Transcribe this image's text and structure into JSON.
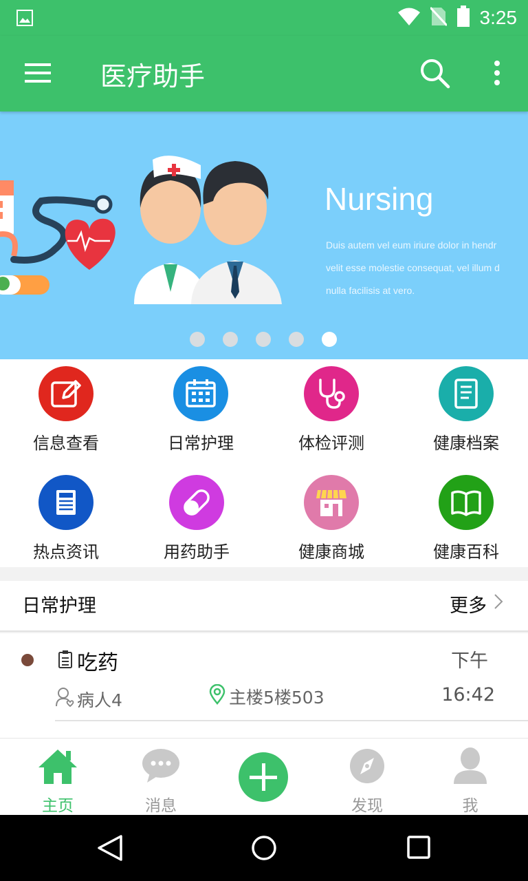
{
  "status_bar": {
    "time": "3:25"
  },
  "app_bar": {
    "title": "医疗助手"
  },
  "banner": {
    "heading": "Nursing",
    "description": [
      "Duis autem vel eum iriure dolor in hendr",
      "velit esse molestie consequat, vel illum d",
      "nulla facilisis at vero."
    ],
    "slide_count": 5,
    "active_slide": 5
  },
  "grid": {
    "items": [
      {
        "label": "信息查看",
        "color": "#e0271e",
        "icon": "edit-icon"
      },
      {
        "label": "日常护理",
        "color": "#1a8fe3",
        "icon": "calendar-icon"
      },
      {
        "label": "体检评测",
        "color": "#e0278a",
        "icon": "stethoscope-icon"
      },
      {
        "label": "健康档案",
        "color": "#1aaeaa",
        "icon": "document-icon"
      },
      {
        "label": "热点资讯",
        "color": "#1157c6",
        "icon": "news-icon"
      },
      {
        "label": "用药助手",
        "color": "#cf3be0",
        "icon": "pill-icon"
      },
      {
        "label": "健康商城",
        "color": "#e07aaa",
        "icon": "store-icon"
      },
      {
        "label": "健康百科",
        "color": "#22a117",
        "icon": "book-icon"
      }
    ]
  },
  "section": {
    "title": "日常护理",
    "more_label": "更多"
  },
  "tasks": [
    {
      "title": "吃药",
      "period": "下午",
      "patient": "病人4",
      "location": "主楼5楼503",
      "time": "16:42"
    }
  ],
  "bottom_nav": {
    "items": [
      {
        "label": "主页",
        "active": true,
        "icon": "home-icon"
      },
      {
        "label": "消息",
        "active": false,
        "icon": "chat-icon"
      },
      {
        "label": "发现",
        "active": false,
        "icon": "compass-icon"
      },
      {
        "label": "我",
        "active": false,
        "icon": "person-icon"
      }
    ]
  },
  "colors": {
    "primary": "#3dc16b",
    "banner_bg": "#7bcffb"
  }
}
